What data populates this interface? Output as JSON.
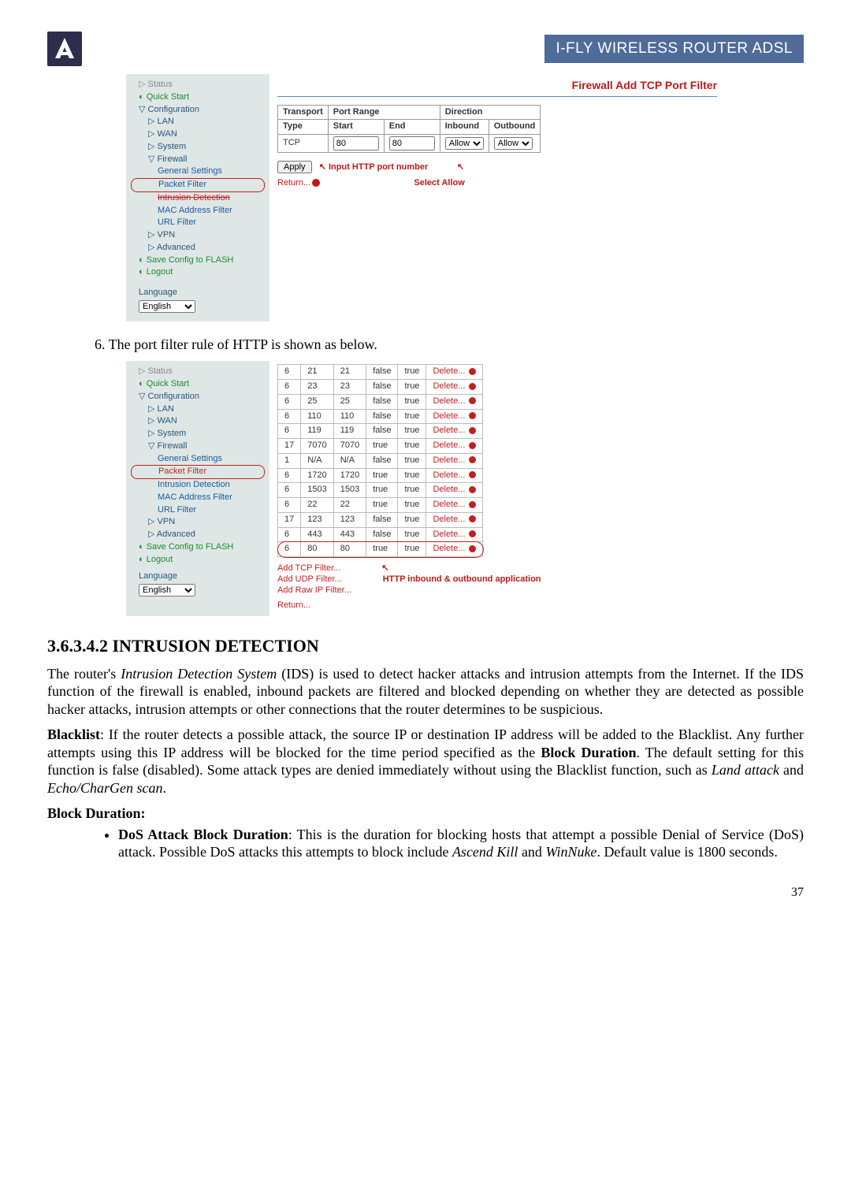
{
  "header": {
    "banner": "I-FLY WIRELESS ROUTER ADSL"
  },
  "shot1": {
    "nav": {
      "status": "Status",
      "quick": "Quick Start",
      "config": "Configuration",
      "lan": "LAN",
      "wan": "WAN",
      "system": "System",
      "firewall": "Firewall",
      "gset": "General Settings",
      "pfilter": "Packet Filter",
      "idet": "Intrusion Detection",
      "mac": "MAC Address Filter",
      "url": "URL Filter",
      "vpn": "VPN",
      "adv": "Advanced",
      "save": "Save Config to FLASH",
      "logout": "Logout",
      "lang_label": "Language",
      "lang_value": "English"
    },
    "right": {
      "title": "Firewall Add TCP Port Filter",
      "th_transport": "Transport",
      "th_portrange": "Port Range",
      "th_direction": "Direction",
      "th_type": "Type",
      "th_start": "Start",
      "th_end": "End",
      "th_inbound": "Inbound",
      "th_outbound": "Outbound",
      "tcp": "TCP",
      "start_val": "80",
      "end_val": "80",
      "allow": "Allow",
      "apply": "Apply",
      "note_input": "Input HTTP port number",
      "note_select": "Select Allow",
      "return": "Return..."
    }
  },
  "step6": "6.   The port filter rule of HTTP is shown as below.",
  "shot2": {
    "nav": {
      "status": "Status",
      "quick": "Quick Start",
      "config": "Configuration",
      "lan": "LAN",
      "wan": "WAN",
      "system": "System",
      "firewall": "Firewall",
      "gset": "General Settings",
      "pfilter": "Packet Filter",
      "idet": "Intrusion Detection",
      "mac": "MAC Address Filter",
      "url": "URL Filter",
      "vpn": "VPN",
      "adv": "Advanced",
      "save": "Save Config to FLASH",
      "logout": "Logout",
      "lang_label": "Language",
      "lang_value": "English"
    },
    "rows": [
      {
        "a": "6",
        "b": "21",
        "c": "21",
        "d": "false",
        "e": "true",
        "f": "Delete..."
      },
      {
        "a": "6",
        "b": "23",
        "c": "23",
        "d": "false",
        "e": "true",
        "f": "Delete..."
      },
      {
        "a": "6",
        "b": "25",
        "c": "25",
        "d": "false",
        "e": "true",
        "f": "Delete..."
      },
      {
        "a": "6",
        "b": "110",
        "c": "110",
        "d": "false",
        "e": "true",
        "f": "Delete..."
      },
      {
        "a": "6",
        "b": "119",
        "c": "119",
        "d": "false",
        "e": "true",
        "f": "Delete..."
      },
      {
        "a": "17",
        "b": "7070",
        "c": "7070",
        "d": "true",
        "e": "true",
        "f": "Delete..."
      },
      {
        "a": "1",
        "b": "N/A",
        "c": "N/A",
        "d": "false",
        "e": "true",
        "f": "Delete..."
      },
      {
        "a": "6",
        "b": "1720",
        "c": "1720",
        "d": "true",
        "e": "true",
        "f": "Delete..."
      },
      {
        "a": "6",
        "b": "1503",
        "c": "1503",
        "d": "true",
        "e": "true",
        "f": "Delete..."
      },
      {
        "a": "6",
        "b": "22",
        "c": "22",
        "d": "true",
        "e": "true",
        "f": "Delete..."
      },
      {
        "a": "17",
        "b": "123",
        "c": "123",
        "d": "false",
        "e": "true",
        "f": "Delete..."
      },
      {
        "a": "6",
        "b": "443",
        "c": "443",
        "d": "false",
        "e": "true",
        "f": "Delete..."
      },
      {
        "a": "6",
        "b": "80",
        "c": "80",
        "d": "true",
        "e": "true",
        "f": "Delete..."
      }
    ],
    "actions": {
      "add_tcp": "Add TCP Filter...",
      "add_udp": "Add UDP Filter...",
      "add_raw": "Add Raw IP Filter...",
      "return": "Return...",
      "note": "HTTP inbound & outbound application"
    }
  },
  "section_title": "3.6.3.4.2 INTRUSION DETECTION",
  "para1": "The router's Intrusion Detection System (IDS) is used to detect hacker attacks and intrusion attempts from the Internet. If the IDS function of the firewall is enabled, inbound packets are filtered and blocked depending on whether they are detected as possible hacker attacks, intrusion attempts or other connections that the router determines to be suspicious.",
  "para2_a": "Blacklist",
  "para2_b": ": If the router detects a possible attack, the source IP or destination IP address will be added to the Blacklist. Any further attempts using this IP address will be blocked for the time period specified as the ",
  "para2_c": "Block Duration",
  "para2_d": ". The default setting for this function is false (disabled). Some attack types are denied immediately without using the Blacklist function, such as ",
  "para2_e": "Land attack",
  "para2_f": " and ",
  "para2_g": "Echo/CharGen scan",
  "para2_h": ".",
  "para3": "Block Duration:",
  "bullet1_a": "DoS Attack Block Duration",
  "bullet1_b": ": This is the duration for blocking hosts that attempt a possible Denial of Service (DoS) attack. Possible DoS attacks this attempts to block include ",
  "bullet1_c": "Ascend Kill",
  "bullet1_d": " and ",
  "bullet1_e": "WinNuke",
  "bullet1_f": ". Default value is 1800 seconds.",
  "page": "37"
}
